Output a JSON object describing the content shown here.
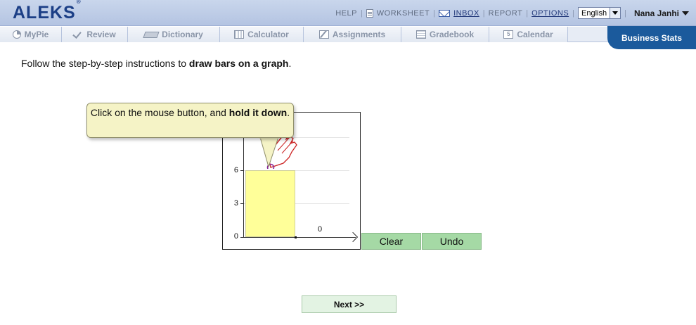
{
  "header": {
    "logo": "ALEKS",
    "logo_mark": "®",
    "links": {
      "help": "HELP",
      "worksheet": "WORKSHEET",
      "inbox": "INBOX",
      "report": "REPORT",
      "options": "OPTIONS"
    },
    "language": "English",
    "user_name": "Nana Janhi"
  },
  "tabs": [
    {
      "label": "MyPie",
      "icon": "pie-icon"
    },
    {
      "label": "Review",
      "icon": "check-icon"
    },
    {
      "label": "Dictionary",
      "icon": "book-icon"
    },
    {
      "label": "Calculator",
      "icon": "calculator-icon"
    },
    {
      "label": "Assignments",
      "icon": "pencil-icon"
    },
    {
      "label": "Gradebook",
      "icon": "grid-icon"
    },
    {
      "label": "Calendar",
      "icon": "calendar-icon"
    }
  ],
  "calendar_icon_text": "5",
  "active_course": "Business Stats",
  "instruction": {
    "prefix": "Follow the step-by-step instructions to ",
    "bold": "draw bars on a graph",
    "suffix": "."
  },
  "tooltip": {
    "prefix": "Click on the mouse button, and ",
    "bold": "hold it down",
    "suffix": "."
  },
  "graph": {
    "y_ticks": [
      "0",
      "3",
      "6"
    ],
    "bar_value_labels": [
      "6",
      "0"
    ]
  },
  "chart_data": {
    "type": "bar",
    "categories": [
      "",
      ""
    ],
    "values": [
      6,
      0
    ],
    "ylim": [
      0,
      9
    ],
    "grid": true
  },
  "buttons": {
    "clear": "Clear",
    "undo": "Undo",
    "next": "Next >>"
  }
}
